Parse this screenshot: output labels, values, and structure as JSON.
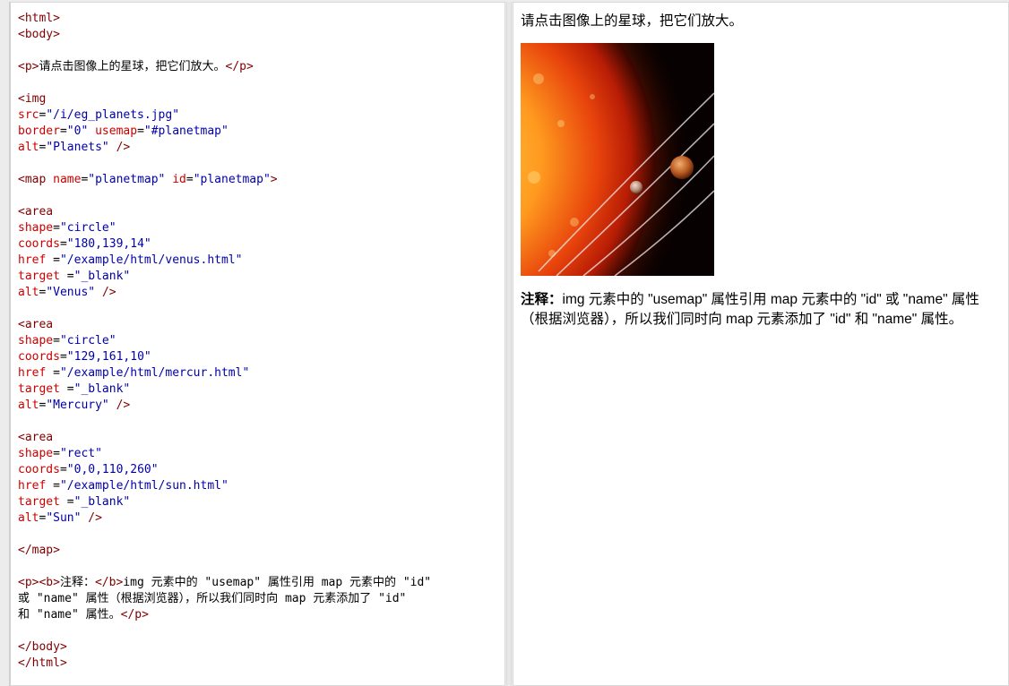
{
  "code_lines": [
    [
      {
        "c": "tag",
        "t": "<html>"
      }
    ],
    [
      {
        "c": "tag",
        "t": "<body>"
      }
    ],
    [],
    [
      {
        "c": "tag",
        "t": "<p>"
      },
      {
        "c": "txt",
        "t": "请点击图像上的星球，把它们放大。"
      },
      {
        "c": "tag",
        "t": "</p>"
      }
    ],
    [],
    [
      {
        "c": "tag",
        "t": "<img"
      }
    ],
    [
      {
        "c": "attr",
        "t": "src"
      },
      {
        "c": "txt",
        "t": "="
      },
      {
        "c": "val",
        "t": "\"/i/eg_planets.jpg\""
      }
    ],
    [
      {
        "c": "attr",
        "t": "border"
      },
      {
        "c": "txt",
        "t": "="
      },
      {
        "c": "val",
        "t": "\"0\""
      },
      {
        "c": "txt",
        "t": " "
      },
      {
        "c": "attr",
        "t": "usemap"
      },
      {
        "c": "txt",
        "t": "="
      },
      {
        "c": "val",
        "t": "\"#planetmap\""
      }
    ],
    [
      {
        "c": "attr",
        "t": "alt"
      },
      {
        "c": "txt",
        "t": "="
      },
      {
        "c": "val",
        "t": "\"Planets\""
      },
      {
        "c": "txt",
        "t": " "
      },
      {
        "c": "tag",
        "t": "/>"
      }
    ],
    [],
    [
      {
        "c": "tag",
        "t": "<map"
      },
      {
        "c": "txt",
        "t": " "
      },
      {
        "c": "attr",
        "t": "name"
      },
      {
        "c": "txt",
        "t": "="
      },
      {
        "c": "val",
        "t": "\"planetmap\""
      },
      {
        "c": "txt",
        "t": " "
      },
      {
        "c": "attr",
        "t": "id"
      },
      {
        "c": "txt",
        "t": "="
      },
      {
        "c": "val",
        "t": "\"planetmap\""
      },
      {
        "c": "tag",
        "t": ">"
      }
    ],
    [],
    [
      {
        "c": "tag",
        "t": "<area"
      }
    ],
    [
      {
        "c": "attr",
        "t": "shape"
      },
      {
        "c": "txt",
        "t": "="
      },
      {
        "c": "val",
        "t": "\"circle\""
      }
    ],
    [
      {
        "c": "attr",
        "t": "coords"
      },
      {
        "c": "txt",
        "t": "="
      },
      {
        "c": "val",
        "t": "\"180,139,14\""
      }
    ],
    [
      {
        "c": "attr",
        "t": "href"
      },
      {
        "c": "txt",
        "t": " ="
      },
      {
        "c": "val",
        "t": "\"/example/html/venus.html\""
      }
    ],
    [
      {
        "c": "attr",
        "t": "target"
      },
      {
        "c": "txt",
        "t": " ="
      },
      {
        "c": "val",
        "t": "\"_blank\""
      }
    ],
    [
      {
        "c": "attr",
        "t": "alt"
      },
      {
        "c": "txt",
        "t": "="
      },
      {
        "c": "val",
        "t": "\"Venus\""
      },
      {
        "c": "txt",
        "t": " "
      },
      {
        "c": "tag",
        "t": "/>"
      }
    ],
    [],
    [
      {
        "c": "tag",
        "t": "<area"
      }
    ],
    [
      {
        "c": "attr",
        "t": "shape"
      },
      {
        "c": "txt",
        "t": "="
      },
      {
        "c": "val",
        "t": "\"circle\""
      }
    ],
    [
      {
        "c": "attr",
        "t": "coords"
      },
      {
        "c": "txt",
        "t": "="
      },
      {
        "c": "val",
        "t": "\"129,161,10\""
      }
    ],
    [
      {
        "c": "attr",
        "t": "href"
      },
      {
        "c": "txt",
        "t": " ="
      },
      {
        "c": "val",
        "t": "\"/example/html/mercur.html\""
      }
    ],
    [
      {
        "c": "attr",
        "t": "target"
      },
      {
        "c": "txt",
        "t": " ="
      },
      {
        "c": "val",
        "t": "\"_blank\""
      }
    ],
    [
      {
        "c": "attr",
        "t": "alt"
      },
      {
        "c": "txt",
        "t": "="
      },
      {
        "c": "val",
        "t": "\"Mercury\""
      },
      {
        "c": "txt",
        "t": " "
      },
      {
        "c": "tag",
        "t": "/>"
      }
    ],
    [],
    [
      {
        "c": "tag",
        "t": "<area"
      }
    ],
    [
      {
        "c": "attr",
        "t": "shape"
      },
      {
        "c": "txt",
        "t": "="
      },
      {
        "c": "val",
        "t": "\"rect\""
      }
    ],
    [
      {
        "c": "attr",
        "t": "coords"
      },
      {
        "c": "txt",
        "t": "="
      },
      {
        "c": "val",
        "t": "\"0,0,110,260\""
      }
    ],
    [
      {
        "c": "attr",
        "t": "href"
      },
      {
        "c": "txt",
        "t": " ="
      },
      {
        "c": "val",
        "t": "\"/example/html/sun.html\""
      }
    ],
    [
      {
        "c": "attr",
        "t": "target"
      },
      {
        "c": "txt",
        "t": " ="
      },
      {
        "c": "val",
        "t": "\"_blank\""
      }
    ],
    [
      {
        "c": "attr",
        "t": "alt"
      },
      {
        "c": "txt",
        "t": "="
      },
      {
        "c": "val",
        "t": "\"Sun\""
      },
      {
        "c": "txt",
        "t": " "
      },
      {
        "c": "tag",
        "t": "/>"
      }
    ],
    [],
    [
      {
        "c": "tag",
        "t": "</map>"
      }
    ],
    [],
    [
      {
        "c": "tag",
        "t": "<p><b>"
      },
      {
        "c": "txt",
        "t": "注释："
      },
      {
        "c": "tag",
        "t": "</b>"
      },
      {
        "c": "txt",
        "t": "img 元素中的 \"usemap\" 属性引用 map 元素中的 \"id\""
      }
    ],
    [
      {
        "c": "txt",
        "t": "或 \"name\" 属性（根据浏览器），所以我们同时向 map 元素添加了 \"id\""
      }
    ],
    [
      {
        "c": "txt",
        "t": "和 \"name\" 属性。"
      },
      {
        "c": "tag",
        "t": "</p>"
      }
    ],
    [],
    [
      {
        "c": "tag",
        "t": "</body>"
      }
    ],
    [
      {
        "c": "tag",
        "t": "</html>"
      }
    ]
  ],
  "result": {
    "intro": "请点击图像上的星球，把它们放大。",
    "image_alt": "Planets",
    "note_label": "注释：",
    "note_text": "img 元素中的 \"usemap\" 属性引用 map 元素中的 \"id\" 或 \"name\" 属性（根据浏览器），所以我们同时向 map 元素添加了 \"id\" 和 \"name\" 属性。"
  },
  "colors": {
    "tag": "#800000",
    "attr": "#cc0000",
    "value": "#0000aa"
  }
}
